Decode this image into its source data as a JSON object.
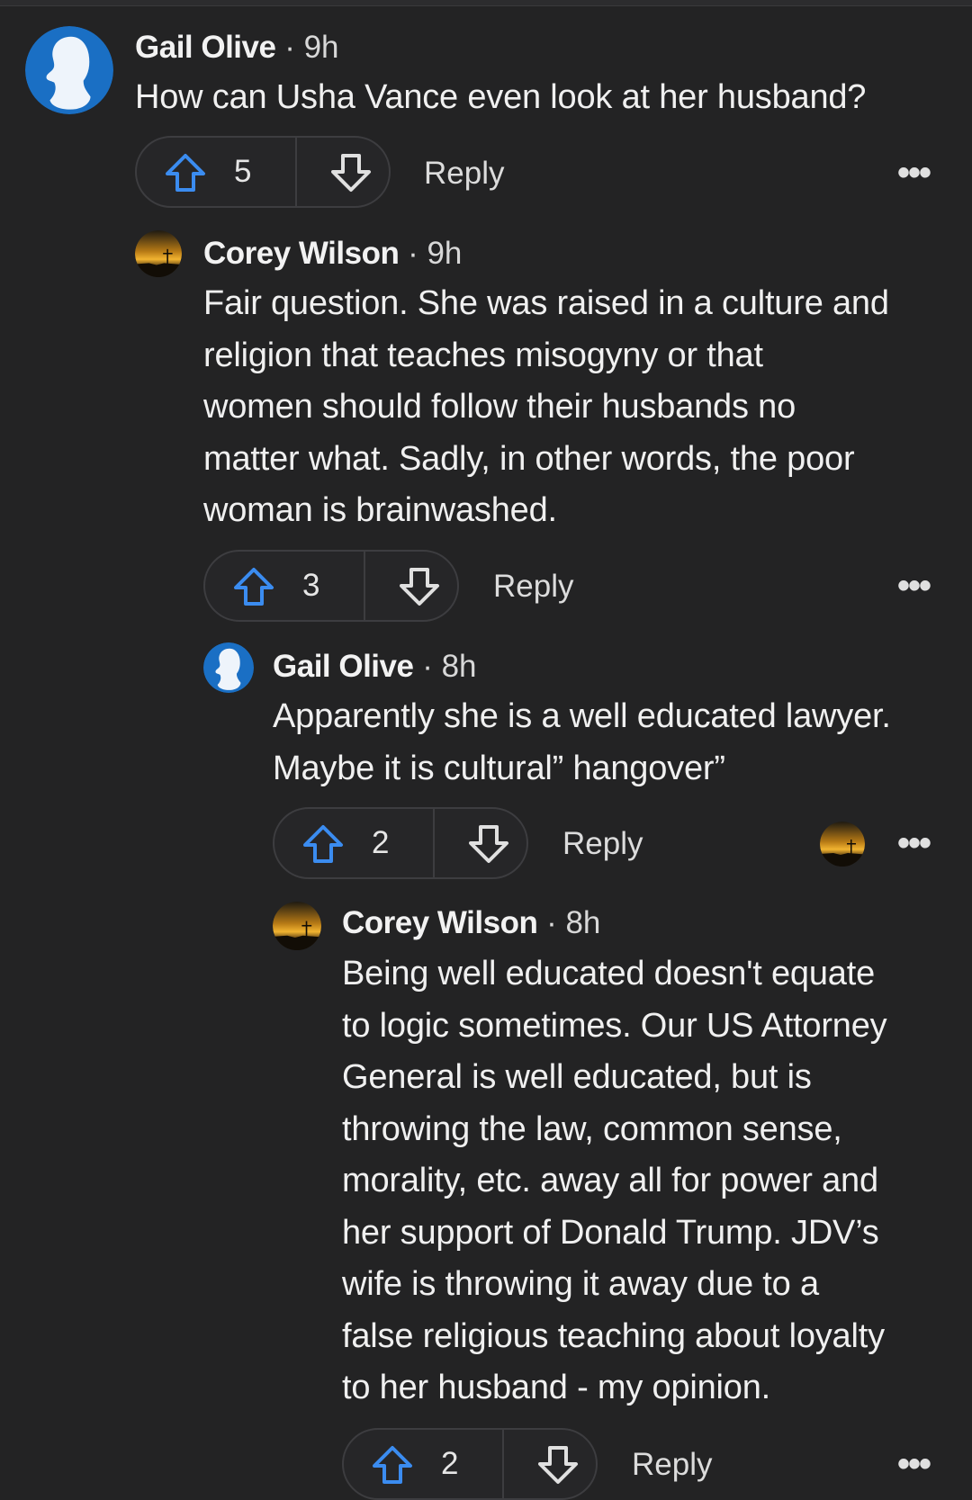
{
  "comments": [
    {
      "author": "Gail Olive",
      "sep": "·",
      "time": "9h",
      "lines": [
        "How can Usha Vance even look at her husband?"
      ],
      "votes": "5",
      "reply": "Reply",
      "more": "•••",
      "avatar": "silhouette-avatar"
    },
    {
      "author": "Corey Wilson",
      "sep": "·",
      "time": "9h",
      "lines": [
        "Fair question. She was raised in a culture and",
        "religion that teaches misogyny or that",
        "women should follow their husbands no",
        "matter what. Sadly, in other words, the poor",
        "woman is brainwashed."
      ],
      "votes": "3",
      "reply": "Reply",
      "more": "•••",
      "avatar": "sunset-avatar"
    },
    {
      "author": "Gail Olive",
      "sep": "·",
      "time": "8h",
      "lines": [
        "Apparently she is a well educated lawyer.",
        "Maybe it is cultural” hangover”"
      ],
      "votes": "2",
      "reply": "Reply",
      "more": "•••",
      "avatar": "silhouette-avatar"
    },
    {
      "author": "Corey Wilson",
      "sep": "·",
      "time": "8h",
      "lines": [
        "Being well educated doesn't equate",
        "to logic sometimes. Our US Attorney",
        "General is well educated, but is",
        "throwing the law, common sense,",
        "morality, etc. away all for power and",
        "her support of Donald Trump. JDV’s",
        "wife is throwing it away due to a",
        "false religious teaching about loyalty",
        "to her husband - my opinion."
      ],
      "votes": "2",
      "reply": "Reply",
      "more": "•••",
      "avatar": "sunset-avatar"
    }
  ],
  "colors": {
    "background": "#232324",
    "upvote": "#3b8cf0",
    "avatar_blue": "#1a6fc4"
  }
}
